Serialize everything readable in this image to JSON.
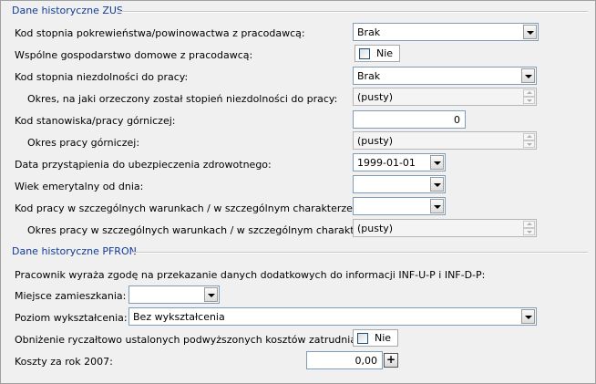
{
  "zus": {
    "title": "Dane historyczne ZUS",
    "rows": {
      "kinship_label": "Kod stopnia pokrewieństwa/powinowactwa z pracodawcą:",
      "kinship_value": "Brak",
      "household_label": "Wspólne gospodarstwo domowe z pracodawcą:",
      "household_check": "Nie",
      "disability_label": "Kod stopnia niezdolności do pracy:",
      "disability_value": "Brak",
      "disability_period_label": "Okres, na jaki orzeczony został stopień niezdolności do pracy:",
      "disability_period_value": "(pusty)",
      "mining_label": "Kod stanowiska/pracy górniczej:",
      "mining_value": "0",
      "mining_period_label": "Okres pracy górniczej:",
      "mining_period_value": "(pusty)",
      "insurance_date_label": "Data przystąpienia do ubezpieczenia zdrowotnego:",
      "insurance_date_value": "1999-01-01",
      "retirement_label": "Wiek emerytalny od dnia:",
      "retirement_value": "",
      "special_work_label": "Kod pracy w szczególnych warunkach / w szczególnym charakterze:",
      "special_work_value": "",
      "special_period_label": "Okres pracy w szczególnych warunkach / w szczególnym charakterze:",
      "special_period_value": "(pusty)"
    }
  },
  "pfron": {
    "title": "Dane historyczne PFRON",
    "rows": {
      "consent_label": "Pracownik wyraża zgodę na przekazanie danych dodatkowych do informacji INF-U-P i INF-D-P:",
      "residence_label": "Miejsce zamieszkania:",
      "residence_value": "",
      "education_label": "Poziom wykształcenia:",
      "education_value": "Bez wykształcenia",
      "cost_reduction_label": "Obniżenie ryczałtowo ustalonych podwyższonych kosztów zatrudniania:",
      "cost_reduction_check": "Nie",
      "costs_label": "Koszty za rok 2007:",
      "costs_value": "0,00",
      "costs_plus": "+"
    }
  }
}
